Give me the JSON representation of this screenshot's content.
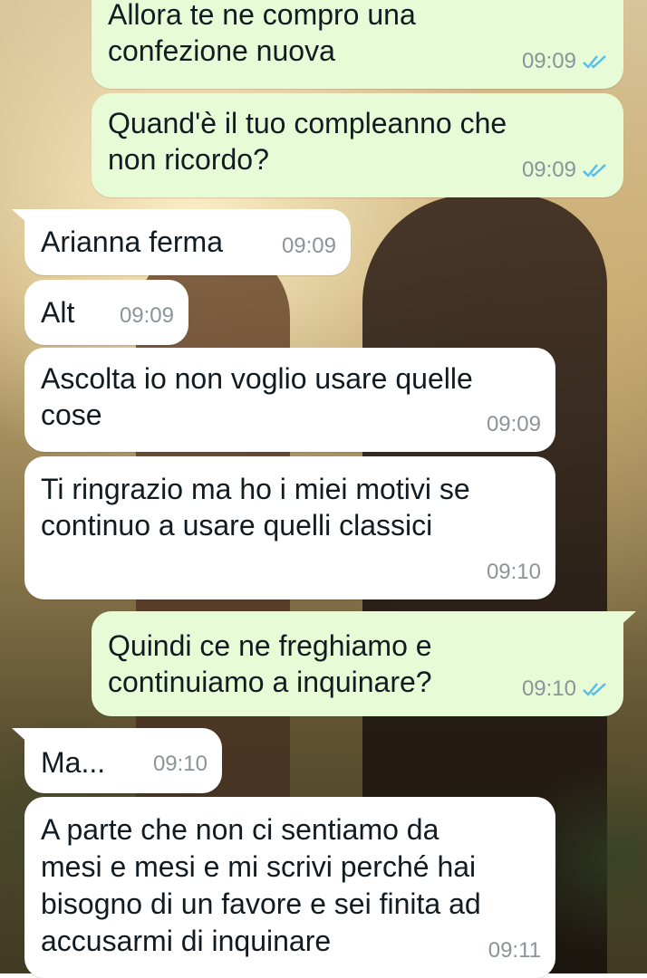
{
  "chat": {
    "messages": [
      {
        "direction": "out",
        "text": "Allora te ne compro una\nconfezione nuova",
        "time": "09:09",
        "status": "read"
      },
      {
        "direction": "out",
        "text": "Quand'è il tuo compleanno che\nnon ricordo?",
        "time": "09:09",
        "status": "read"
      },
      {
        "direction": "in",
        "text": "Arianna ferma",
        "time": "09:09"
      },
      {
        "direction": "in",
        "text": "Alt",
        "time": "09:09"
      },
      {
        "direction": "in",
        "text": "Ascolta io non voglio usare quelle\ncose",
        "time": "09:09"
      },
      {
        "direction": "in",
        "text": "Ti ringrazio ma ho i miei motivi se\ncontinuo a usare quelli classici",
        "time": "09:10"
      },
      {
        "direction": "out",
        "text": "Quindi ce ne freghiamo e\ncontinuiamo a inquinare?",
        "time": "09:10",
        "status": "read"
      },
      {
        "direction": "in",
        "text": "Ma...",
        "time": "09:10"
      },
      {
        "direction": "in",
        "text": "A parte che non ci sentiamo da\nmesi e mesi e mi scrivi perché hai\nbisogno di un favore e sei finita ad\naccusarmi di inquinare",
        "time": "09:11"
      }
    ],
    "colors": {
      "outgoing_bubble": "#e7fcd6",
      "incoming_bubble": "#ffffff",
      "read_tick": "#53bdeb",
      "timestamp": "#8a9499"
    },
    "icons": {
      "read_receipt": "double-check-icon"
    }
  }
}
